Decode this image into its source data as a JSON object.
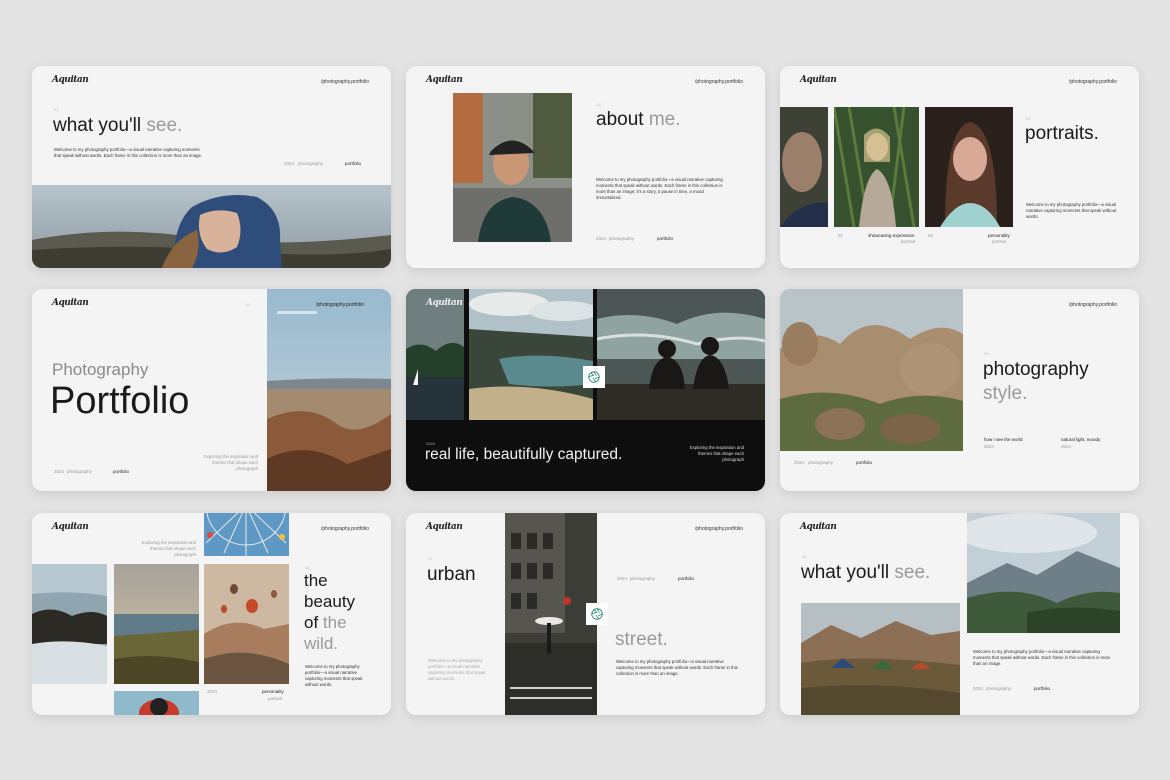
{
  "brand": "Aquitan",
  "url": "/photography.portfolio",
  "welcome": "Welcome to my photography portfolio—a visual narrative capturing moments that speak without words. Each frame in this collection is more than an image.",
  "welcome_long": "Welcome to my photography portfolio—a visual narrative capturing moments that speak without words. Each frame in this collection is more than an image; it's a story, a pause in time, a mood immortalized.",
  "welcome_short": "Welcome to my photography portfolio—a visual narrative capturing moments that speak without words.",
  "explore": "Exploring the inspiration and themes that shape each photograph",
  "slides": {
    "see1": {
      "num": "01",
      "t1": "what you'll ",
      "t2": "see.",
      "m1": "2024",
      "m2": "photography",
      "m3": "portfolio"
    },
    "about": {
      "num": "02",
      "t1": "about ",
      "t2": "me.",
      "m1": "2024",
      "m2": "photography",
      "m3": "portfolio"
    },
    "portraits": {
      "num": "03",
      "t1": "portraits.",
      "c1a": "01",
      "c1b": "showcasing expression",
      "c1c": "portrait",
      "c2a": "02",
      "c2b": "personality",
      "c2c": "portrait"
    },
    "portfolio": {
      "num": "04",
      "t1": "Photography",
      "t2": "Portfolio",
      "m1": "2024",
      "m2": "photography",
      "m3": "portfolio"
    },
    "reallife": {
      "num": "2024",
      "t1": "real life, beautifully captured."
    },
    "style": {
      "num": "05",
      "t1": "photography",
      "t2": "style.",
      "c1": "how i see the world",
      "c1b": "2024",
      "c2": "natural light, moody",
      "c2b": "2024",
      "m1": "2024",
      "m2": "photography",
      "m3": "portfolio"
    },
    "beauty": {
      "num": "06",
      "l1": "the",
      "l2": "beauty",
      "l3": "of ",
      "l3b": "the",
      "l4": "wild.",
      "m1": "2024",
      "m2": "personality",
      "m3": "portrait"
    },
    "urban": {
      "num": "07",
      "t1": "urban",
      "t2": "street.",
      "m1": "2024",
      "m2": "photography",
      "m3": "portfolio"
    },
    "see2": {
      "num": "08",
      "t1": "what you'll ",
      "t2": "see.",
      "m1": "2024",
      "m2": "photography",
      "m3": "portfolio"
    }
  }
}
